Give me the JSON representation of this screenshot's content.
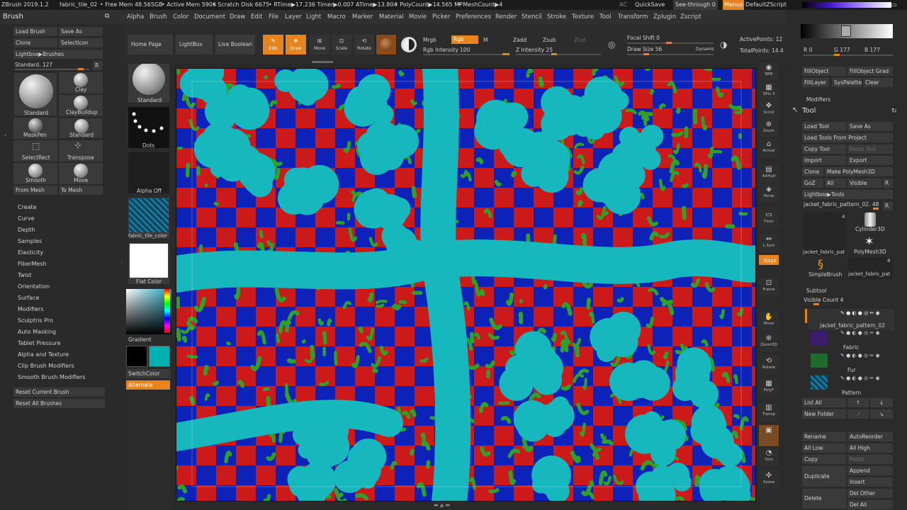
{
  "titlebar": {
    "app": "ZBrush 2019.1.2",
    "doc": "fabric_tile_02",
    "free_mem": "• Free Mem 48.565GB",
    "active_mem": "• Active Mem 5906",
    "scratch": "• Scratch Disk 6675",
    "rtime": "• RTime▶17.236 Timer▶0.007 ATime▶13.804",
    "polycount": "• PolyCount▶14.565 MP",
    "meshcount": "• MeshCount▶4",
    "ac": "AC",
    "quicksave": "QuickSave",
    "seethrough": "See-through 0",
    "menus": "Menus",
    "script": "DefaultZScript"
  },
  "menus": [
    "Alpha",
    "Brush",
    "Color",
    "Document",
    "Draw",
    "Edit",
    "File",
    "Layer",
    "Light",
    "Macro",
    "Marker",
    "Material",
    "Movie",
    "Picker",
    "Preferences",
    "Render",
    "Stencil",
    "Stroke",
    "Texture",
    "Tool",
    "Transform",
    "Zplugin",
    "Zscript"
  ],
  "brush": {
    "title": "Brush",
    "load": "Load Brush",
    "saveas": "Save As",
    "clone": "Clone",
    "selecticon": "SelectIcon",
    "lightbox": "Lightbox▶Brushes",
    "standard_val": "Standard. 127",
    "r": "R",
    "items": [
      {
        "n": "Standard"
      },
      {
        "n": "Clay"
      },
      {
        "n": "ClayBuildup"
      },
      {
        "n": "MaskPen"
      },
      {
        "n": "Standard"
      },
      {
        "n": "SelectRect"
      },
      {
        "n": "Transpose"
      },
      {
        "n": "Smooth"
      },
      {
        "n": "Move"
      }
    ],
    "from_mesh": "From Mesh",
    "to_mesh": "To Mesh",
    "sections": [
      "Create",
      "Curve",
      "Depth",
      "Samples",
      "Elasticity",
      "FiberMesh",
      "Twist",
      "Orientation",
      "Surface",
      "Modifiers",
      "Sculptris Pro",
      "Auto Masking",
      "Tablet Pressure",
      "Alpha and Texture",
      "Clip Brush Modifiers",
      "Smooth Brush Modifiers"
    ],
    "reset_current": "Reset Current Brush",
    "reset_all": "Reset All Brushes"
  },
  "shelf": {
    "standard": "Standard",
    "dots": "Dots",
    "alpha_off": "Alpha Off",
    "texture": "fabric_tile_color",
    "material": "Flat Color",
    "gradient": "Gradient",
    "switchcolor": "SwitchColor",
    "alternate": "Alternate"
  },
  "toolbar": {
    "home": "Home Page",
    "lightbox": "LightBox",
    "liveboolean": "Live Boolean",
    "edit": "Edit",
    "draw": "Draw",
    "move": "Move",
    "scale": "Scale",
    "rotate": "Rotate",
    "mrgb": "Mrgb",
    "rgb": "Rgb",
    "m": "M",
    "rgb_intensity": "Rgb Intensity 100",
    "zadd": "Zadd",
    "zsub": "Zsub",
    "zcut": "Zcut",
    "z_intensity": "Z Intensity 25",
    "focal": "Focal Shift 0",
    "drawsize": "Draw Size 56",
    "dynamic": "Dynamic",
    "activepoints": "ActivePoints: 12",
    "totalpoints": "TotalPoints: 14.4"
  },
  "righttools": [
    "BPR",
    "SPix 3",
    "Scroll",
    "Zoom",
    "Actual",
    "AAHalf",
    "Persp",
    "Floor",
    "L.Sym",
    "",
    "Frame",
    "Move",
    "Zoom3D",
    "Rotate",
    "PolyF",
    "Transp",
    "",
    "Solo",
    "Xpose"
  ],
  "color": {
    "r": "R 0",
    "g": "G 177",
    "b": "B 177",
    "main": "#00b1b1"
  },
  "fillbtns": {
    "fillobject": "FillObject",
    "fillobjectgrad": "FillObject Grad",
    "filllayer": "FillLayer",
    "syspalette": "SysPalette",
    "clear": "Clear"
  },
  "modifiers": "Modifiers",
  "tool": {
    "title": "Tool",
    "load": "Load Tool",
    "saveas": "Save As",
    "load_project": "Load Tools From Project",
    "copy": "Copy Tool",
    "paste": "Paste Tool",
    "import": "Import",
    "export": "Export",
    "clone": "Clone",
    "make_polymesh": "Make PolyMesh3D",
    "goz": "GoZ",
    "all": "All",
    "visible": "Visible",
    "r": "R",
    "lightbox": "Lightbox▶Tools",
    "current": "jacket_fabric_pattern_02. 48",
    "count4": "4",
    "cyl": "Cylinder3D",
    "poly": "PolyMesh3D",
    "simple": "SimpleBrush",
    "jacket1": "jacket_fabric_pat",
    "jacket2": "jacket_fabric_pat"
  },
  "subtool": {
    "title": "Subtool",
    "visible_count": "Visible Count 4",
    "items": [
      "jacket_fabric_pattern_02",
      "Fabric",
      "Fur",
      "Pattern"
    ],
    "listall": "List All",
    "newfolder": "New Folder",
    "rename": "Rename",
    "autoreorder": "AutoReorder",
    "alllow": "All Low",
    "allhigh": "All High",
    "copy": "Copy",
    "paste": "Paste",
    "duplicate": "Duplicate",
    "append": "Append",
    "insert": "Insert",
    "delete": "Delete",
    "delother": "Del Other",
    "delall": "Del All"
  }
}
